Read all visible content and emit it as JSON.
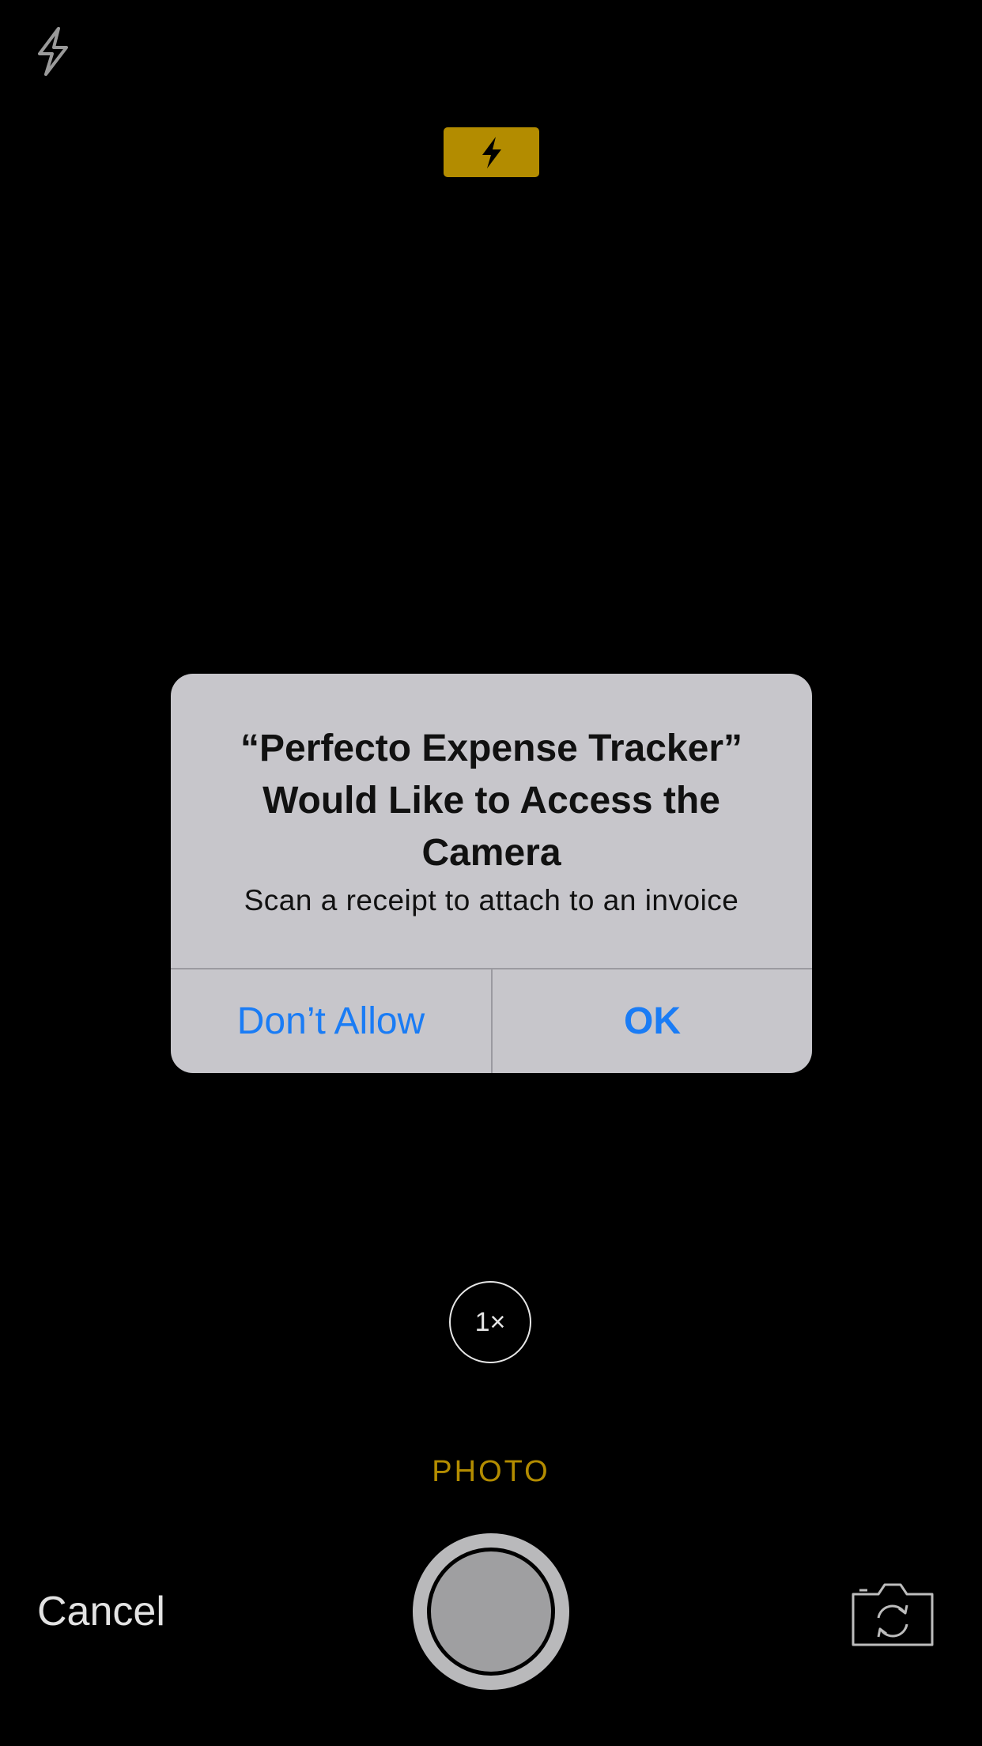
{
  "camera": {
    "zoom_label": "1×",
    "mode_label": "PHOTO",
    "cancel_label": "Cancel",
    "icons": {
      "flash_toggle": "flash-icon",
      "flash_indicator": "flash-icon",
      "shutter": "shutter-button",
      "switch_camera": "switch-camera-icon"
    },
    "colors": {
      "accent_yellow": "#b38c00",
      "background": "#000000"
    }
  },
  "alert": {
    "title": "“Perfecto Expense Tracker”\nWould Like to Access the\nCamera",
    "message": "Scan a receipt to attach to an invoice",
    "buttons": {
      "dont_allow": "Don’t Allow",
      "ok": "OK"
    },
    "colors": {
      "button_blue": "#1a7cf5",
      "background": "#c7c6cb"
    }
  }
}
